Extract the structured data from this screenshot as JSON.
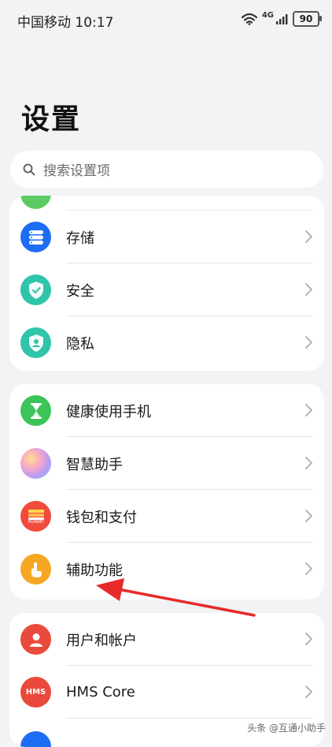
{
  "status_bar": {
    "carrier_time": "中国移动 10:17",
    "network": "4G",
    "battery": "90"
  },
  "page": {
    "title": "设置"
  },
  "search": {
    "placeholder": "搜索设置项"
  },
  "groups": [
    {
      "items": [
        {
          "label": "存储",
          "icon": "storage-icon",
          "color": "#1d6df5"
        },
        {
          "label": "安全",
          "icon": "security-shield-icon",
          "color": "#30c4a9"
        },
        {
          "label": "隐私",
          "icon": "privacy-shield-icon",
          "color": "#30c4a9"
        }
      ]
    },
    {
      "items": [
        {
          "label": "健康使用手机",
          "icon": "hourglass-icon",
          "color": "#3cc45a"
        },
        {
          "label": "智慧助手",
          "icon": "assistant-orb-icon",
          "color": "#c8a0f0"
        },
        {
          "label": "钱包和支付",
          "icon": "wallet-icon",
          "color": "#f04b3c",
          "icon_text": "HUAWEI"
        },
        {
          "label": "辅助功能",
          "icon": "hand-pointer-icon",
          "color": "#f5a623"
        }
      ]
    },
    {
      "items": [
        {
          "label": "用户和帐户",
          "icon": "user-icon",
          "color": "#ea4a3c"
        },
        {
          "label": "HMS Core",
          "icon": "hms-icon",
          "color": "#ea4a3c",
          "icon_text": "HMS"
        }
      ]
    }
  ],
  "annotation": {
    "color": "#e62a2a"
  },
  "watermark": "头条 @互通小助手"
}
